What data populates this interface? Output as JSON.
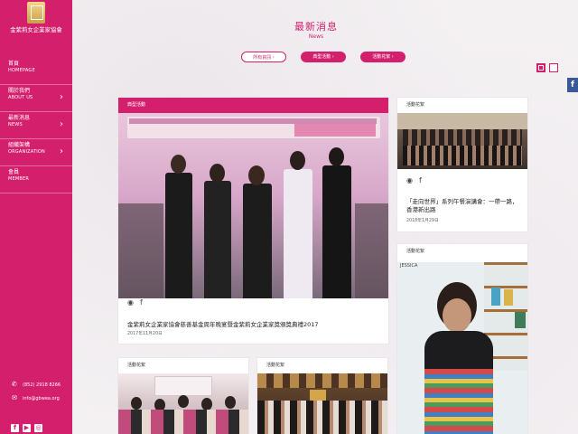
{
  "sidebar": {
    "logo_name": "金紫荊女企業家協會",
    "items": [
      {
        "zh": "首頁",
        "en": "HOMEPAGE",
        "has_chevron": false
      },
      {
        "zh": "關於我們",
        "en": "ABOUT US",
        "has_chevron": true
      },
      {
        "zh": "最新消息",
        "en": "NEWS",
        "has_chevron": true
      },
      {
        "zh": "組織架構",
        "en": "ORGANIZATION",
        "has_chevron": true
      },
      {
        "zh": "會員",
        "en": "MEMBER",
        "has_chevron": false
      }
    ],
    "phone": "(852) 2918 8266",
    "email": "info@gbwea.org",
    "social_icons": [
      "facebook-icon",
      "youtube-icon",
      "instagram-icon"
    ]
  },
  "header": {
    "title_zh": "最新消息",
    "title_en": "News"
  },
  "filters": [
    {
      "label": "所有資訊",
      "style": "outline"
    },
    {
      "label": "典型活動",
      "style": "filled"
    },
    {
      "label": "活動花絮",
      "style": "filled"
    }
  ],
  "cards": {
    "featured": {
      "category": "典型活動",
      "caption": "金紫荊女企業家協會慈善基金周年晚宴暨金紫荊女企業家獎頒獎典禮2017",
      "date": "2017年11月20日"
    },
    "right_top": {
      "category": "活動花絮",
      "caption": "「走向世界」系列午餐演講會：一帶一路，香港新出路",
      "date": "2018年1月29日"
    },
    "right_bottom": {
      "category": "活動花絮",
      "photo_text": "JESSICA"
    },
    "bottom_left": {
      "category": "活動花絮"
    },
    "bottom_middle": {
      "category": "活動花絮"
    }
  },
  "colors": {
    "brand": "#d41f6c",
    "facebook": "#3b5998"
  }
}
